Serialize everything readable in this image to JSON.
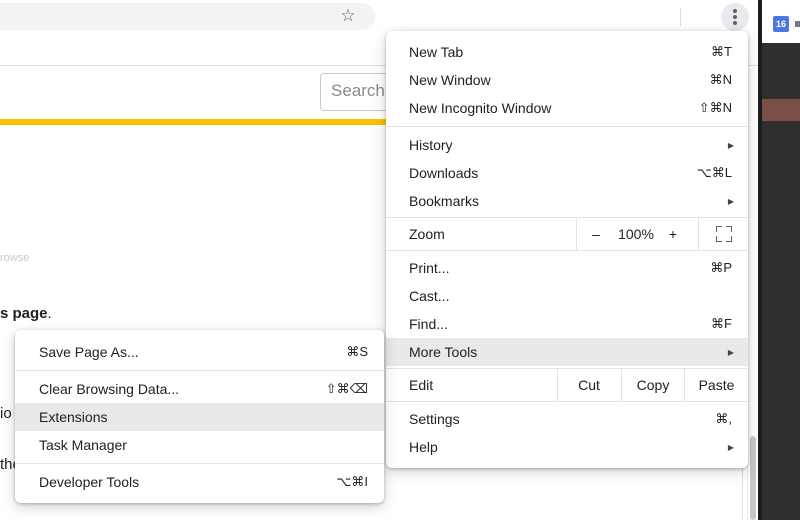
{
  "background_page": {
    "search_placeholder": "Search",
    "fragment_page": "s page",
    "fragment_period": ".",
    "fragment_io": "io",
    "fragment_the": "the",
    "fragment_faint_1": "rowse"
  },
  "dock": {
    "calendar_day": "16"
  },
  "main_menu": {
    "group1": [
      {
        "label": "New Tab",
        "shortcut": "⌘T"
      },
      {
        "label": "New Window",
        "shortcut": "⌘N"
      },
      {
        "label": "New Incognito Window",
        "shortcut": "⇧⌘N"
      }
    ],
    "group2": [
      {
        "label": "History",
        "submenu": true
      },
      {
        "label": "Downloads",
        "shortcut": "⌥⌘L"
      },
      {
        "label": "Bookmarks",
        "submenu": true
      }
    ],
    "zoom": {
      "label": "Zoom",
      "minus": "–",
      "value": "100%",
      "plus": "+"
    },
    "group3": [
      {
        "label": "Print...",
        "shortcut": "⌘P"
      },
      {
        "label": "Cast..."
      },
      {
        "label": "Find...",
        "shortcut": "⌘F"
      },
      {
        "label": "More Tools",
        "submenu": true,
        "highlighted": true
      }
    ],
    "edit": {
      "label": "Edit",
      "cut": "Cut",
      "copy": "Copy",
      "paste": "Paste"
    },
    "group4": [
      {
        "label": "Settings",
        "shortcut": "⌘,"
      },
      {
        "label": "Help",
        "submenu": true
      }
    ]
  },
  "more_tools_menu": {
    "items": [
      {
        "label": "Save Page As...",
        "shortcut": "⌘S"
      },
      {
        "label": "Clear Browsing Data...",
        "shortcut": "⇧⌘⌫"
      },
      {
        "label": "Extensions",
        "highlighted": true
      },
      {
        "label": "Task Manager"
      },
      {
        "label": "Developer Tools",
        "shortcut": "⌥⌘I"
      }
    ]
  },
  "icons": [
    "star-icon",
    "kebab-menu-icon",
    "submenu-arrow-icon",
    "fullscreen-icon",
    "calendar-icon"
  ],
  "colors": {
    "accent_yellow": "#f5c400",
    "menu_highlight": "#e8e9eb",
    "menu_bg": "#ffffff"
  }
}
